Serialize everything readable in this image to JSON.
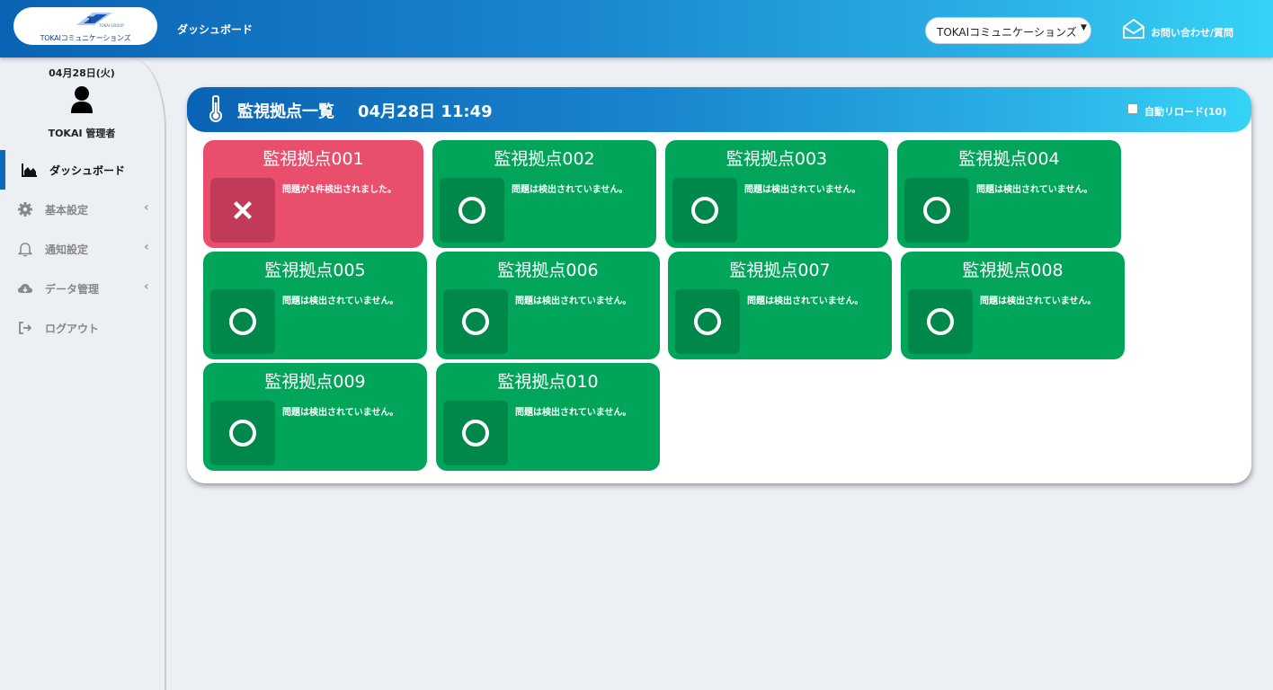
{
  "header": {
    "logo_group": "TOKAI GROUP",
    "logo_text": "TOKAIコミュニケーションズ",
    "title": "ダッシュボード",
    "company_select": "TOKAIコミュニケーションズ",
    "contact_label": "お問い合わせ/質問",
    "colors": {
      "gradient_start": "#0a63b4",
      "gradient_end": "#36d3f7"
    }
  },
  "sidebar": {
    "date": "04月28日(火)",
    "user": "TOKAI 管理者",
    "items": [
      {
        "label": "ダッシュボード",
        "icon": "chart-area-icon",
        "active": true
      },
      {
        "label": "基本設定",
        "icon": "gear-icon",
        "has_submenu": true
      },
      {
        "label": "通知設定",
        "icon": "bell-icon",
        "has_submenu": true
      },
      {
        "label": "データ管理",
        "icon": "cloud-download-icon",
        "has_submenu": true
      },
      {
        "label": "ログアウト",
        "icon": "sign-out-icon"
      }
    ]
  },
  "panel": {
    "title": "監視拠点一覧",
    "timestamp": "04月28日 11:49",
    "auto_reload_label": "自動リロード(10)",
    "auto_reload_checked": false
  },
  "sites": [
    {
      "name": "監視拠点001",
      "status": "alert",
      "message": "問題が1件検出されました。"
    },
    {
      "name": "監視拠点002",
      "status": "ok",
      "message": "問題は検出されていません。"
    },
    {
      "name": "監視拠点003",
      "status": "ok",
      "message": "問題は検出されていません。"
    },
    {
      "name": "監視拠点004",
      "status": "ok",
      "message": "問題は検出されていません。"
    },
    {
      "name": "監視拠点005",
      "status": "ok",
      "message": "問題は検出されていません。"
    },
    {
      "name": "監視拠点006",
      "status": "ok",
      "message": "問題は検出されていません。"
    },
    {
      "name": "監視拠点007",
      "status": "ok",
      "message": "問題は検出されていません。"
    },
    {
      "name": "監視拠点008",
      "status": "ok",
      "message": "問題は検出されていません。"
    },
    {
      "name": "監視拠点009",
      "status": "ok",
      "message": "問題は検出されていません。"
    },
    {
      "name": "監視拠点010",
      "status": "ok",
      "message": "問題は検出されていません。"
    }
  ],
  "colors": {
    "ok": "#00a55a",
    "alert": "#ea4e6d"
  }
}
